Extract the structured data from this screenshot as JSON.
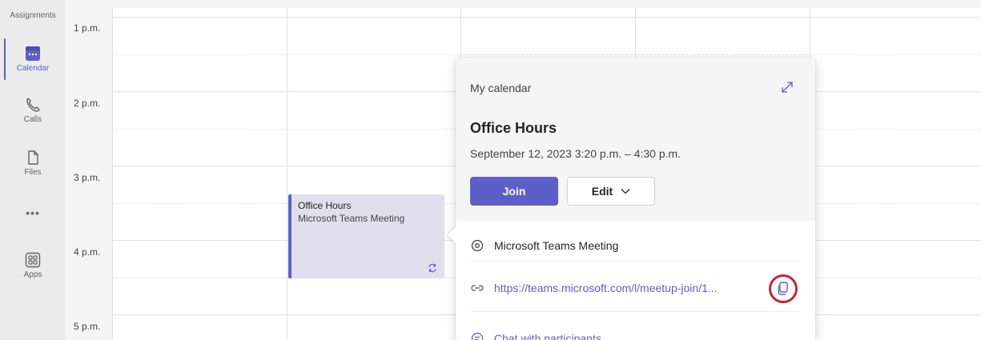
{
  "rail": {
    "items": [
      {
        "label": "Assignments",
        "icon": "assignments-icon"
      },
      {
        "label": "Calendar",
        "icon": "calendar-icon",
        "active": true
      },
      {
        "label": "Calls",
        "icon": "phone-icon"
      },
      {
        "label": "Files",
        "icon": "file-icon"
      },
      {
        "label": "•••",
        "icon": "more-icon"
      },
      {
        "label": "Apps",
        "icon": "apps-icon"
      }
    ]
  },
  "calendar": {
    "time_labels": [
      "1 p.m.",
      "2 p.m.",
      "3 p.m.",
      "4 p.m.",
      "5 p.m."
    ]
  },
  "event": {
    "title": "Office Hours",
    "subtitle": "Microsoft Teams Meeting",
    "recurring_icon": "repeat-icon"
  },
  "popover": {
    "calendar_name": "My calendar",
    "title": "Office Hours",
    "datetime": "September 12, 2023 3:20 p.m. – 4:30 p.m.",
    "join_label": "Join",
    "edit_label": "Edit",
    "location": "Microsoft Teams Meeting",
    "link": "https://teams.microsoft.com/l/meetup-join/1...",
    "chat_label": "Chat with participants"
  },
  "colors": {
    "accent": "#5b5fc7",
    "highlight_ring": "#c4262e",
    "event_bg": "#e1dfee"
  }
}
